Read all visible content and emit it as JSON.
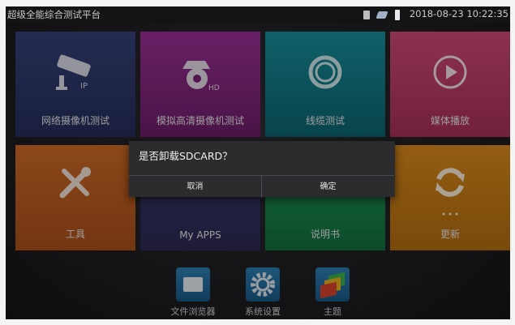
{
  "statusbar": {
    "title": "超级全能综合测试平台",
    "datetime": "2018-08-23 10:22:35",
    "icons": [
      "sdcard-icon",
      "usb-icon",
      "battery-icon"
    ]
  },
  "tiles": [
    {
      "label": "网络摄像机测试",
      "icon": "ip-camera-icon",
      "color": "#2f3a70"
    },
    {
      "label": "模拟高清摄像机测试",
      "icon": "ptz-camera-hd-icon",
      "color": "#8a2784"
    },
    {
      "label": "线缆测试",
      "icon": "cable-coil-icon",
      "color": "#137c88"
    },
    {
      "label": "媒体播放",
      "icon": "play-icon",
      "color": "#c03e66"
    },
    {
      "label": "工具",
      "icon": "tools-icon",
      "color": "#bd5d20"
    },
    {
      "label": "My APPS",
      "icon": "apps-icon",
      "color": "#353363"
    },
    {
      "label": "说明书",
      "icon": "manual-icon",
      "color": "#198a4f"
    },
    {
      "label": "更新",
      "icon": "refresh-icon",
      "color": "#c87b16"
    }
  ],
  "dock": [
    {
      "label": "文件浏览器",
      "icon": "folder-icon"
    },
    {
      "label": "系统设置",
      "icon": "gear-icon"
    },
    {
      "label": "主题",
      "icon": "theme-icon"
    }
  ],
  "dialog": {
    "message": "是否卸载SDCARD？",
    "cancel": "取消",
    "ok": "确定"
  }
}
